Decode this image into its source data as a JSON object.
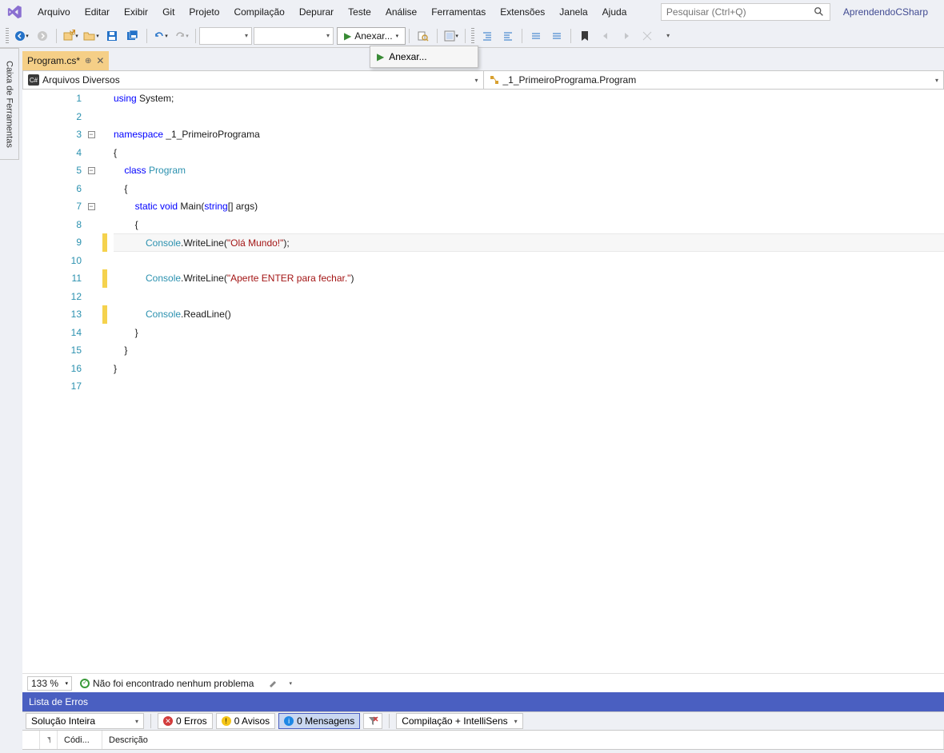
{
  "menu": [
    "Arquivo",
    "Editar",
    "Exibir",
    "Git",
    "Projeto",
    "Compilação",
    "Depurar",
    "Teste",
    "Análise",
    "Ferramentas",
    "Extensões",
    "Janela",
    "Ajuda"
  ],
  "search_placeholder": "Pesquisar (Ctrl+Q)",
  "solution_name": "AprendendoCSharp",
  "attach_label": "Anexar...",
  "attach_popup_label": "Anexar...",
  "sidebar_label": "Caixa de Ferramentas",
  "tab_name": "Program.cs*",
  "nav_left": "Arquivos Diversos",
  "nav_right": "_1_PrimeiroPrograma.Program",
  "lines": [
    "1",
    "2",
    "3",
    "4",
    "5",
    "6",
    "7",
    "8",
    "9",
    "10",
    "11",
    "12",
    "13",
    "14",
    "15",
    "16",
    "17"
  ],
  "code": {
    "l1_kw": "using ",
    "l1_plain": "System;",
    "l3_kw": "namespace ",
    "l3_plain": "_1_PrimeiroPrograma",
    "l4": "{",
    "l5_kw": "class ",
    "l5_type": "Program",
    "l6": "    {",
    "l7_kw1": "static ",
    "l7_kw2": "void ",
    "l7_plain1": "Main(",
    "l7_kw3": "string",
    "l7_plain2": "[] args)",
    "l8": "        {",
    "l9_type": "Console",
    "l9_plain1": ".WriteLine(",
    "l9_str": "\"Olá Mundo!\"",
    "l9_plain2": ");",
    "l11_type": "Console",
    "l11_plain1": ".WriteLine(",
    "l11_str": "\"Aperte ENTER para fechar.\"",
    "l11_plain2": ")",
    "l13_type": "Console",
    "l13_plain": ".ReadLine()",
    "l14": "        }",
    "l15": "    }",
    "l16": "}"
  },
  "zoom": "133 %",
  "no_problem_text": "Não foi encontrado nenhum problema",
  "errlist_title": "Lista de Erros",
  "err_scope": "Solução Inteira",
  "err_counts": {
    "errors": "0 Erros",
    "warnings": "0 Avisos",
    "messages": "0 Mensagens"
  },
  "err_build_filter": "Compilação + IntelliSens",
  "err_cols": {
    "code": "Códi...",
    "desc": "Descrição"
  }
}
